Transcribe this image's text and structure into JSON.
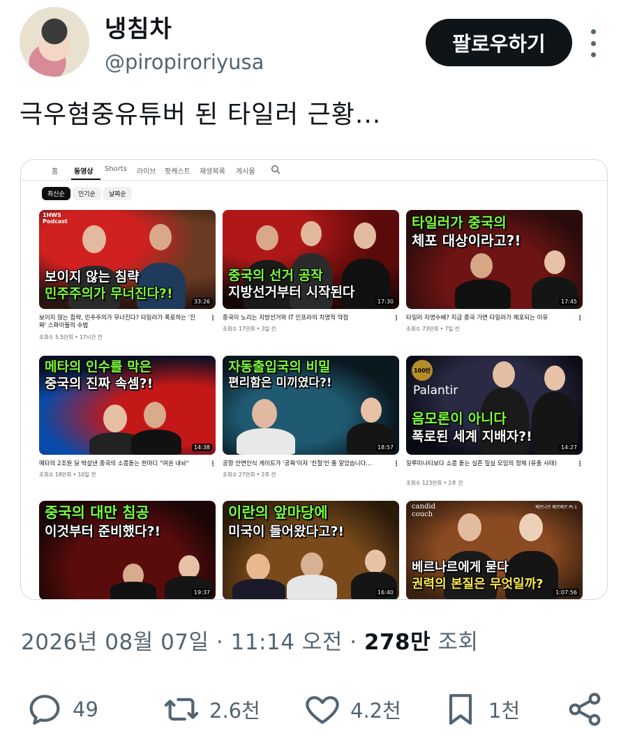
{
  "user": {
    "display_name": "냉침차",
    "handle": "@piropiroriyusa",
    "follow_label": "팔로우하기"
  },
  "tweet": {
    "text": "극우혐중유튜버 된 타일러 근황...",
    "timestamp_prefix": "2026년 08월 07일 · 11:14 오전 · ",
    "views_count": "278만",
    "views_suffix": " 조회"
  },
  "actions": {
    "replies": "49",
    "retweets": "2.6천",
    "likes": "4.2천",
    "bookmarks": "1천"
  },
  "youtube": {
    "tabs": [
      "홈",
      "동영상",
      "Shorts",
      "라이브",
      "팟캐스트",
      "재생목록",
      "게시물"
    ],
    "chips": [
      "최신순",
      "인기순",
      "날짜순"
    ],
    "videos": [
      {
        "caption1": "보이지 않는 침략",
        "caption2": "민주주의가 무너진다?!",
        "badge": "1HWS Podcast",
        "duration": "33:26",
        "title": "보이지 않는 침략, 민주주의가 무너진다? 타일러가 폭로하는 '진짜' 스파이들의 수법",
        "meta": "조회수 5.5만회 • 17시간 전"
      },
      {
        "caption1": "중국의 선거 공작",
        "caption2": "지방선거부터 시작된다",
        "duration": "17:30",
        "title": "중국이 노리는 지방선거와 IT 인프라의 치명적 약점",
        "meta": "조회수 17만회 • 3일 전"
      },
      {
        "caption1": "타일러가 중국의",
        "caption2": "체포 대상이라고?!",
        "duration": "17:45",
        "title": "타일러 지명수배? 지금 중국 가면 타일러가 체포되는 이유",
        "meta": "조회수 73만회 • 7일 전"
      },
      {
        "caption1": "메타의 인수를 막은",
        "caption2": "중국의 진짜 속셈?!",
        "duration": "14:38",
        "title": "메타의 2조원 딜 박살낸 중국의 소름돋는 한마디 \"여권 내놔\"",
        "meta": "조회수 18만회 • 10일 전"
      },
      {
        "caption1": "자동출입국의 비밀",
        "caption2": "편리함은 미끼였다?!",
        "duration": "18:57",
        "title": "공항 안면인식 게이트가 '공짜'이자 '친절'인 줄 알았습니다...",
        "meta": "조회수 27만회 • 2주 전"
      },
      {
        "caption1": "음모론이 아니다",
        "caption2": "폭로된 세계 지배자?!",
        "badge": "Palantir",
        "badge2": "100만",
        "duration": "14:27",
        "title": "일루미나티보다 소름 돋는 실존 밀실 모임의 정체 (유출 사태)",
        "meta": "조회수 123만회 • 2주 전"
      },
      {
        "caption1": "중국의 대만 침공",
        "caption2": "이것부터 준비했다?!",
        "duration": "19:37"
      },
      {
        "caption1": "이란의 앞마당에",
        "caption2": "미국이 들어왔다고?!",
        "duration": "16:40"
      },
      {
        "caption1": "베르나르에게 묻다",
        "caption2": "권력의 본질은 무엇일까?",
        "badge": "candid couch",
        "badge2": "베르나르 베르베르 Pt.1",
        "duration": "1:07:56"
      }
    ]
  },
  "colors": {
    "follow_bg": "#0f1419",
    "secondary_text": "#536471",
    "caption_green": "#7CFC3A",
    "caption_yellow": "#FFE94A"
  }
}
